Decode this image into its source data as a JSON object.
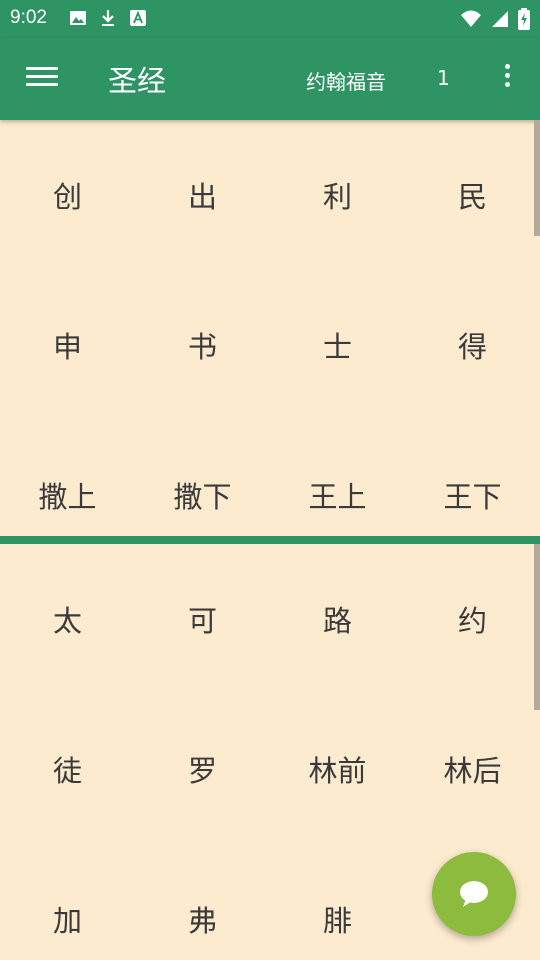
{
  "status_bar": {
    "time": "9:02"
  },
  "toolbar": {
    "title": "圣经",
    "book": "约翰福音",
    "chapter": "1"
  },
  "old_testament": {
    "books": [
      "创",
      "出",
      "利",
      "民",
      "申",
      "书",
      "士",
      "得",
      "撒上",
      "撒下",
      "王上",
      "王下"
    ]
  },
  "new_testament": {
    "books": [
      "太",
      "可",
      "路",
      "约",
      "徒",
      "罗",
      "林前",
      "林后",
      "加",
      "弗",
      "腓"
    ]
  },
  "colors": {
    "primary": "#2E9464",
    "background": "#FDEBD0",
    "fab": "#8DBB3E",
    "text": "#3A3A3A"
  },
  "icons": {
    "menu": "menu-icon",
    "more": "more-vert-icon",
    "fab": "chat-bubble-icon"
  }
}
